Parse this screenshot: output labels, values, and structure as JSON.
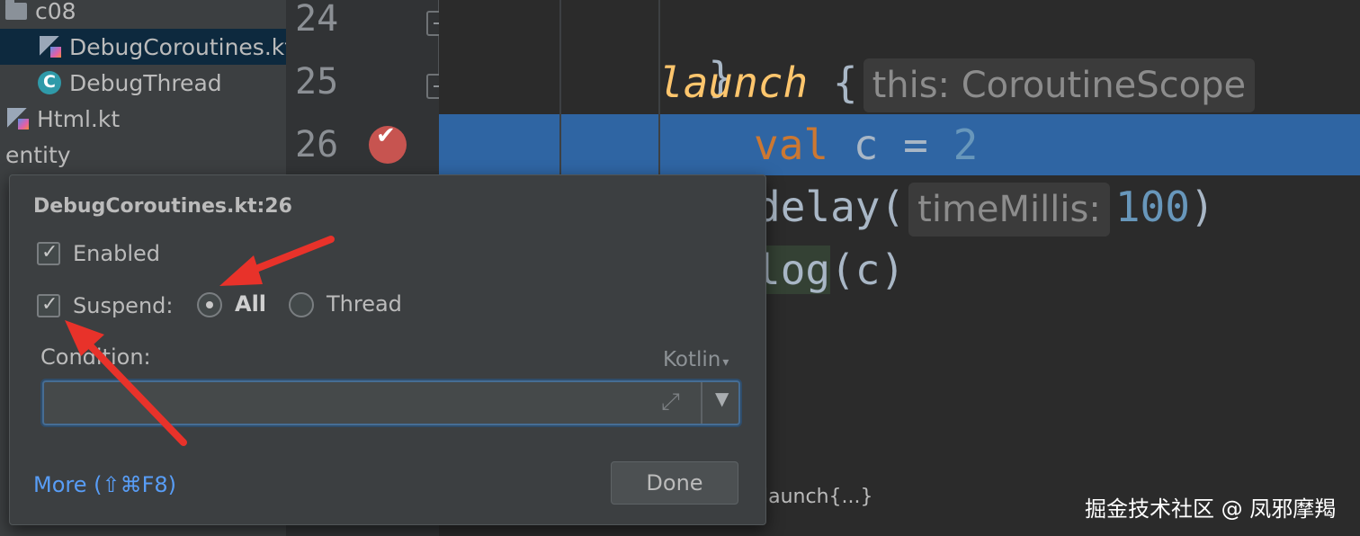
{
  "project_tree": {
    "items": [
      {
        "label": "c08",
        "icon": "folder-icon"
      },
      {
        "label": "DebugCoroutines.kt",
        "icon": "kotlin-file-icon"
      },
      {
        "label": "DebugThread",
        "icon": "class-icon"
      },
      {
        "label": "Html.kt",
        "icon": "kotlin-file-icon"
      },
      {
        "label": "entity",
        "icon": ""
      }
    ]
  },
  "gutter": {
    "line_numbers": [
      "24",
      "25",
      "26"
    ]
  },
  "editor": {
    "line24": "}",
    "line25_keyword": "launch",
    "line25_brace": " {",
    "line25_hint": "this: CoroutineScope",
    "line26_keyword": "val",
    "line26_var": " c = ",
    "line26_value": "2",
    "line27_func": "delay(",
    "line27_hint": "timeMillis:",
    "line27_value": "100",
    "line27_close": ")",
    "line28_func": "log",
    "line28_args": "(c)",
    "breadcrumb": "launch{...}"
  },
  "breakpoint_popup": {
    "title": "DebugCoroutines.kt:26",
    "enabled_label": "Enabled",
    "enabled_checked": true,
    "suspend_label": "Suspend:",
    "suspend_checked": true,
    "suspend_options": [
      "All",
      "Thread"
    ],
    "suspend_selected": "All",
    "condition_label": "Condition:",
    "condition_language": "Kotlin",
    "condition_value": "",
    "more_link": "More (⇧⌘F8)",
    "done_label": "Done"
  },
  "watermark": "掘金技术社区 @ 凤邪摩羯",
  "colors": {
    "annotation_arrow": "#e8322a",
    "selection_line": "#2f65a3",
    "link": "#589df6"
  }
}
